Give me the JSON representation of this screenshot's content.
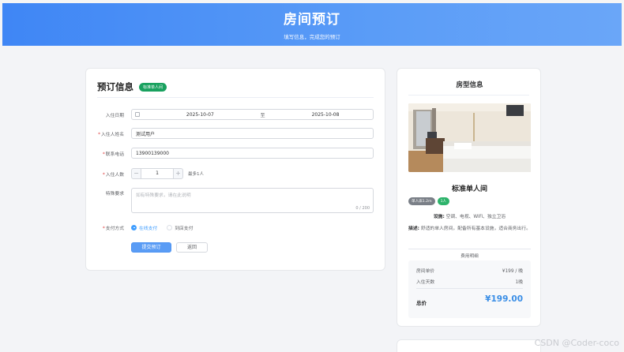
{
  "header": {
    "title": "房间预订",
    "subtitle": "填写信息，完成您的预订"
  },
  "form": {
    "title": "预订信息",
    "room_tag": "标准单人间",
    "checkin_label": "入住日期",
    "checkin_start": "2025-10-07",
    "range_sep": "至",
    "checkin_end": "2025-10-08",
    "name_label": "入住人姓名",
    "name_value": "测试用户",
    "phone_label": "联系电话",
    "phone_value": "13900139000",
    "guests_label": "入住人数",
    "guests_value": "1",
    "guests_minus": "−",
    "guests_plus": "+",
    "guests_hint": "最多1人",
    "special_label": "特殊要求",
    "special_placeholder": "如有特殊要求，请在此说明",
    "special_counter": "0 / 200",
    "pay_label": "支付方式",
    "pay_options": [
      "在线支付",
      "到店支付"
    ],
    "pay_selected": "在线支付",
    "submit_label": "提交预订",
    "back_label": "返回"
  },
  "room": {
    "panel_title": "房型信息",
    "name": "标准单人间",
    "badges": [
      "单人床1.2m",
      "1人"
    ],
    "facilities_label": "设施:",
    "facilities_value": "空调、电视、WiFi、独立卫浴",
    "desc_label": "描述:",
    "desc_value": "舒适的单人房间，配备所有基本设施，适合商务出行。",
    "fee_title": "费用明细",
    "unit_price_label": "房间单价",
    "unit_price_value": "¥199 / 晚",
    "nights_label": "入住天数",
    "nights_value": "1晚",
    "total_label": "总价",
    "total_value": "¥199.00"
  },
  "watermark": "CSDN @Coder-coco",
  "colors": {
    "header": "#4a90f5",
    "primary": "#409eff",
    "tag_green": "#19a15f",
    "total": "#3a8ee6"
  }
}
